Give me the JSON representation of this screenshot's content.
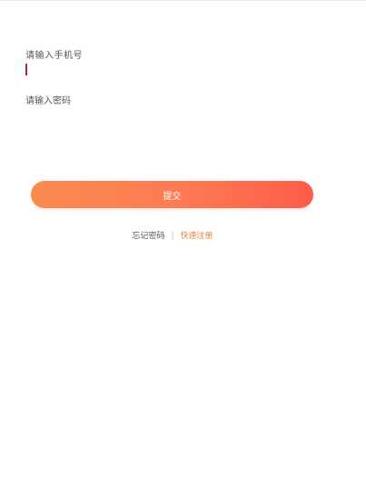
{
  "form": {
    "phone_placeholder": "请输入手机号",
    "password_placeholder": "请输入密码",
    "submit_label": "提交"
  },
  "links": {
    "forgot_password": "忘记密码",
    "divider": "|",
    "quick_register": "快速注册"
  },
  "colors": {
    "button_gradient_start": "#fb8a50",
    "button_gradient_end": "#fd5c4a",
    "register_link": "#f08040",
    "caret": "#b0283a"
  }
}
